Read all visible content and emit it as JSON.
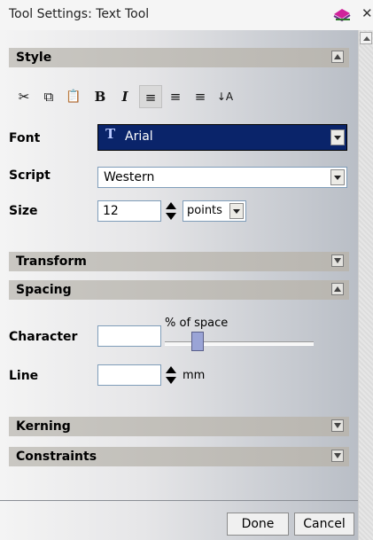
{
  "window": {
    "title": "Tool Settings: Text Tool"
  },
  "sections": {
    "style": "Style",
    "transform": "Transform",
    "spacing": "Spacing",
    "kerning": "Kerning",
    "constraints": "Constraints"
  },
  "toolbar": {
    "cut": "✂",
    "copy": "⧉",
    "paste": "📋",
    "bold": "B",
    "italic": "I",
    "align_left": "≡",
    "align_center": "≡",
    "align_right": "≡",
    "sort": "↓A"
  },
  "fields": {
    "font_label": "Font",
    "font_value": "Arial",
    "script_label": "Script",
    "script_value": "Western",
    "size_label": "Size",
    "size_value": "12",
    "size_unit": "points",
    "character_label": "Character",
    "character_value": "",
    "character_unit": "% of space",
    "line_label": "Line",
    "line_value": "",
    "line_unit": "mm"
  },
  "buttons": {
    "done": "Done",
    "cancel": "Cancel"
  },
  "colors": {
    "font_highlight": "#0a246a",
    "section_bar": "#c0beb8"
  }
}
